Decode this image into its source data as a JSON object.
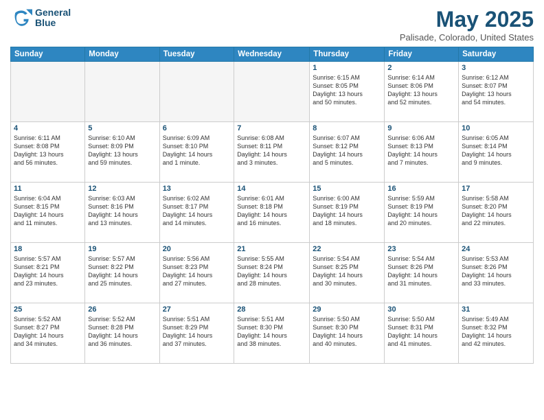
{
  "header": {
    "logo_line1": "General",
    "logo_line2": "Blue",
    "month_title": "May 2025",
    "location": "Palisade, Colorado, United States"
  },
  "weekdays": [
    "Sunday",
    "Monday",
    "Tuesday",
    "Wednesday",
    "Thursday",
    "Friday",
    "Saturday"
  ],
  "weeks": [
    [
      {
        "day": "",
        "info": ""
      },
      {
        "day": "",
        "info": ""
      },
      {
        "day": "",
        "info": ""
      },
      {
        "day": "",
        "info": ""
      },
      {
        "day": "1",
        "info": "Sunrise: 6:15 AM\nSunset: 8:05 PM\nDaylight: 13 hours\nand 50 minutes."
      },
      {
        "day": "2",
        "info": "Sunrise: 6:14 AM\nSunset: 8:06 PM\nDaylight: 13 hours\nand 52 minutes."
      },
      {
        "day": "3",
        "info": "Sunrise: 6:12 AM\nSunset: 8:07 PM\nDaylight: 13 hours\nand 54 minutes."
      }
    ],
    [
      {
        "day": "4",
        "info": "Sunrise: 6:11 AM\nSunset: 8:08 PM\nDaylight: 13 hours\nand 56 minutes."
      },
      {
        "day": "5",
        "info": "Sunrise: 6:10 AM\nSunset: 8:09 PM\nDaylight: 13 hours\nand 59 minutes."
      },
      {
        "day": "6",
        "info": "Sunrise: 6:09 AM\nSunset: 8:10 PM\nDaylight: 14 hours\nand 1 minute."
      },
      {
        "day": "7",
        "info": "Sunrise: 6:08 AM\nSunset: 8:11 PM\nDaylight: 14 hours\nand 3 minutes."
      },
      {
        "day": "8",
        "info": "Sunrise: 6:07 AM\nSunset: 8:12 PM\nDaylight: 14 hours\nand 5 minutes."
      },
      {
        "day": "9",
        "info": "Sunrise: 6:06 AM\nSunset: 8:13 PM\nDaylight: 14 hours\nand 7 minutes."
      },
      {
        "day": "10",
        "info": "Sunrise: 6:05 AM\nSunset: 8:14 PM\nDaylight: 14 hours\nand 9 minutes."
      }
    ],
    [
      {
        "day": "11",
        "info": "Sunrise: 6:04 AM\nSunset: 8:15 PM\nDaylight: 14 hours\nand 11 minutes."
      },
      {
        "day": "12",
        "info": "Sunrise: 6:03 AM\nSunset: 8:16 PM\nDaylight: 14 hours\nand 13 minutes."
      },
      {
        "day": "13",
        "info": "Sunrise: 6:02 AM\nSunset: 8:17 PM\nDaylight: 14 hours\nand 14 minutes."
      },
      {
        "day": "14",
        "info": "Sunrise: 6:01 AM\nSunset: 8:18 PM\nDaylight: 14 hours\nand 16 minutes."
      },
      {
        "day": "15",
        "info": "Sunrise: 6:00 AM\nSunset: 8:19 PM\nDaylight: 14 hours\nand 18 minutes."
      },
      {
        "day": "16",
        "info": "Sunrise: 5:59 AM\nSunset: 8:19 PM\nDaylight: 14 hours\nand 20 minutes."
      },
      {
        "day": "17",
        "info": "Sunrise: 5:58 AM\nSunset: 8:20 PM\nDaylight: 14 hours\nand 22 minutes."
      }
    ],
    [
      {
        "day": "18",
        "info": "Sunrise: 5:57 AM\nSunset: 8:21 PM\nDaylight: 14 hours\nand 23 minutes."
      },
      {
        "day": "19",
        "info": "Sunrise: 5:57 AM\nSunset: 8:22 PM\nDaylight: 14 hours\nand 25 minutes."
      },
      {
        "day": "20",
        "info": "Sunrise: 5:56 AM\nSunset: 8:23 PM\nDaylight: 14 hours\nand 27 minutes."
      },
      {
        "day": "21",
        "info": "Sunrise: 5:55 AM\nSunset: 8:24 PM\nDaylight: 14 hours\nand 28 minutes."
      },
      {
        "day": "22",
        "info": "Sunrise: 5:54 AM\nSunset: 8:25 PM\nDaylight: 14 hours\nand 30 minutes."
      },
      {
        "day": "23",
        "info": "Sunrise: 5:54 AM\nSunset: 8:26 PM\nDaylight: 14 hours\nand 31 minutes."
      },
      {
        "day": "24",
        "info": "Sunrise: 5:53 AM\nSunset: 8:26 PM\nDaylight: 14 hours\nand 33 minutes."
      }
    ],
    [
      {
        "day": "25",
        "info": "Sunrise: 5:52 AM\nSunset: 8:27 PM\nDaylight: 14 hours\nand 34 minutes."
      },
      {
        "day": "26",
        "info": "Sunrise: 5:52 AM\nSunset: 8:28 PM\nDaylight: 14 hours\nand 36 minutes."
      },
      {
        "day": "27",
        "info": "Sunrise: 5:51 AM\nSunset: 8:29 PM\nDaylight: 14 hours\nand 37 minutes."
      },
      {
        "day": "28",
        "info": "Sunrise: 5:51 AM\nSunset: 8:30 PM\nDaylight: 14 hours\nand 38 minutes."
      },
      {
        "day": "29",
        "info": "Sunrise: 5:50 AM\nSunset: 8:30 PM\nDaylight: 14 hours\nand 40 minutes."
      },
      {
        "day": "30",
        "info": "Sunrise: 5:50 AM\nSunset: 8:31 PM\nDaylight: 14 hours\nand 41 minutes."
      },
      {
        "day": "31",
        "info": "Sunrise: 5:49 AM\nSunset: 8:32 PM\nDaylight: 14 hours\nand 42 minutes."
      }
    ]
  ]
}
